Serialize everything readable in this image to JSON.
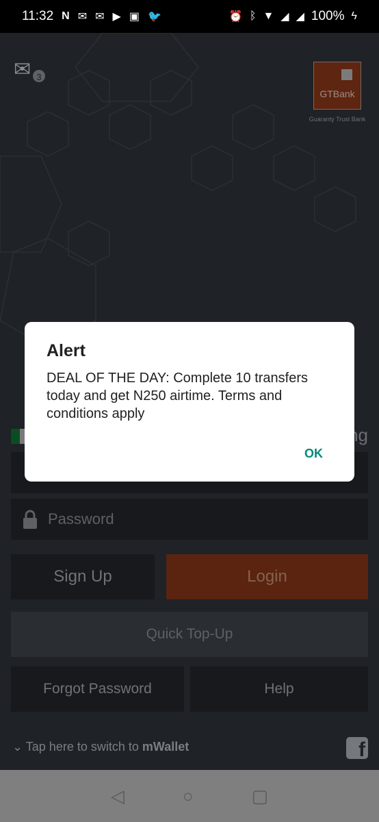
{
  "status_bar": {
    "time": "11:32",
    "battery": "100%",
    "left_icons": [
      "netflix-icon",
      "gmail-icon",
      "gmail-icon",
      "youtube-icon",
      "gallery-icon",
      "twitter-icon"
    ],
    "right_icons": [
      "alarm-icon",
      "bluetooth-icon",
      "wifi-icon",
      "signal-icon",
      "signal-icon"
    ]
  },
  "header": {
    "mail_count": "3",
    "logo_text": "GTBank",
    "logo_tagline": "Guaranty Trust Bank"
  },
  "login": {
    "partial_label": "ng",
    "password_placeholder": "Password",
    "signup": "Sign Up",
    "login": "Login",
    "quick_topup": "Quick Top-Up",
    "forgot": "Forgot Password",
    "help": "Help",
    "switch_prefix": "Tap here to switch to ",
    "switch_target": "mWallet"
  },
  "dialog": {
    "title": "Alert",
    "message": "DEAL OF THE DAY: Complete 10 transfers today and get N250 airtime.  Terms and conditions apply",
    "ok": "OK"
  },
  "colors": {
    "brand": "#dd4f05",
    "ok": "#00897b"
  }
}
